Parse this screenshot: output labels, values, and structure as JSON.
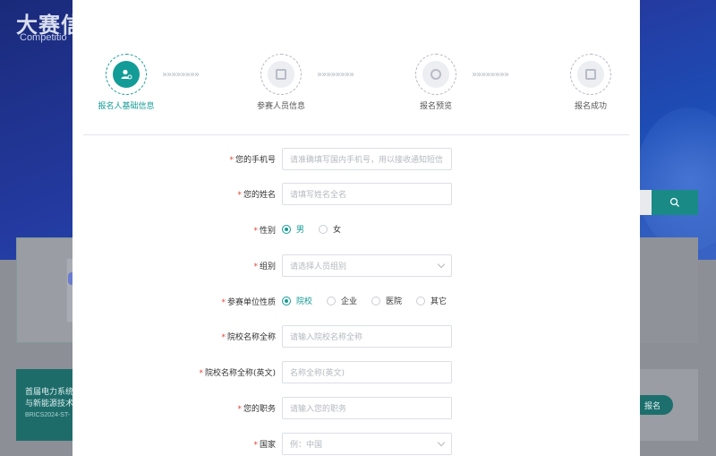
{
  "background": {
    "title": "大赛信",
    "subtitle": "Competitio",
    "card": {
      "line1": "首届电力系统",
      "line2": "与新能源技术",
      "code": "BRICS2024-ST-"
    },
    "signup_label": "报名"
  },
  "steps": [
    {
      "label": "报名人基础信息",
      "icon": "user-badge-icon",
      "active": true
    },
    {
      "label": "参赛人员信息",
      "icon": "document-icon",
      "active": false
    },
    {
      "label": "报名预览",
      "icon": "preview-icon",
      "active": false
    },
    {
      "label": "报名成功",
      "icon": "success-file-icon",
      "active": false
    }
  ],
  "arrow_glyphs": "»»»»»»»»",
  "form": {
    "phone": {
      "label": "您的手机号",
      "placeholder": "请准确填写国内手机号，用以接收通知短信"
    },
    "name": {
      "label": "您的姓名",
      "placeholder": "请填写姓名全名"
    },
    "gender": {
      "label": "性别",
      "options": [
        "男",
        "女"
      ],
      "selected": "男"
    },
    "group": {
      "label": "组别",
      "placeholder": "请选择人员组别"
    },
    "org_type": {
      "label": "参赛单位性质",
      "options": [
        "院校",
        "企业",
        "医院",
        "其它"
      ],
      "selected": "院校"
    },
    "school_name": {
      "label": "院校名称全称",
      "placeholder": "请输入院校名称全称"
    },
    "school_name_en": {
      "label": "院校名称全称(英文)",
      "placeholder": "名称全称(英文)"
    },
    "position": {
      "label": "您的职务",
      "placeholder": "请输入您的职务"
    },
    "country": {
      "label": "国家",
      "placeholder": "例：中国"
    }
  },
  "colors": {
    "accent": "#139c97",
    "required": "#e0453b"
  }
}
